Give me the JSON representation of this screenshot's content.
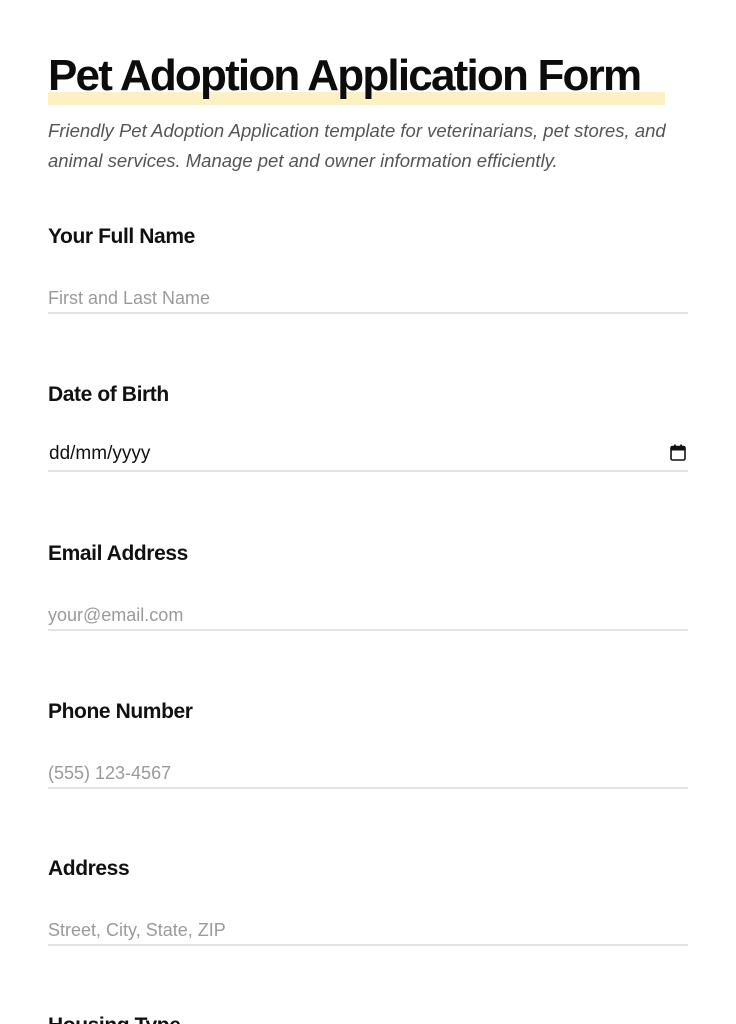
{
  "form": {
    "title": "Pet Adoption Application Form",
    "description": "Friendly Pet Adoption Application template for veterinarians, pet stores, and animal services. Manage pet and owner information efficiently."
  },
  "fields": {
    "full_name": {
      "label": "Your Full Name",
      "placeholder": "First and Last Name",
      "value": ""
    },
    "date_of_birth": {
      "label": "Date of Birth",
      "display": "dd/mm/yyyy",
      "icon": "calendar-icon"
    },
    "email": {
      "label": "Email Address",
      "placeholder": "your@email.com",
      "value": ""
    },
    "phone": {
      "label": "Phone Number",
      "placeholder": "(555) 123-4567",
      "value": ""
    },
    "address": {
      "label": "Address",
      "placeholder": "Street, City, State, ZIP",
      "value": ""
    },
    "housing_type": {
      "label": "Housing Type"
    }
  },
  "colors": {
    "title_highlight": "#fdf0c4",
    "field_underline": "#e4e4e4",
    "placeholder": "#9a9a9a",
    "subtitle": "#555555"
  }
}
